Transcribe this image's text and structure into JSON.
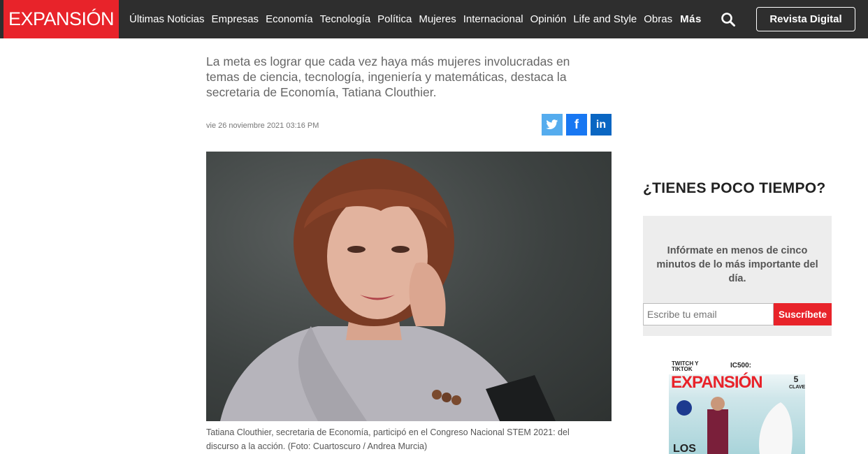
{
  "header": {
    "logo": "EXPANSIÓN",
    "nav": [
      "Últimas Noticias",
      "Empresas",
      "Economía",
      "Tecnología",
      "Política",
      "Mujeres",
      "Internacional",
      "Opinión",
      "Life and Style",
      "Obras"
    ],
    "more": "Más",
    "search_icon": "search-icon",
    "revista": "Revista Digital"
  },
  "article": {
    "summary": "La meta es lograr que cada vez haya más mujeres involucradas en temas de ciencia, tecnología, ingeniería y matemáticas, destaca la secretaria de Economía, Tatiana Clouthier.",
    "date": "vie 26 noviembre 2021 03:16 PM",
    "share": {
      "twitter_icon": "twitter-icon",
      "facebook_icon": "facebook-icon",
      "linkedin_icon": "linkedin-icon"
    },
    "caption": "Tatiana Clouthier, secretaria de Economía, participó en el Congreso Nacional STEM 2021: del discurso a la acción.   (Foto: Cuartoscuro / Andrea Murcia)"
  },
  "sidebar": {
    "title": "¿TIENES POCO TIEMPO?",
    "newsletter_text": "Infórmate en menos de cinco minutos de lo más importante del día.",
    "email_placeholder": "Escribe tu email",
    "subscribe": "Suscríbete",
    "magazine": {
      "top_left": "TWITCH Y TIKTOK",
      "top_right": "IC500:",
      "logo": "EXPANSIÓN",
      "badge_number": "5",
      "badge_text": "CLAVES",
      "cover_word": "LOS"
    }
  },
  "colors": {
    "brand_red": "#e8232a",
    "topbar": "#2e2e2e",
    "twitter": "#55acee",
    "facebook": "#1877f2",
    "linkedin": "#0a66c2"
  }
}
